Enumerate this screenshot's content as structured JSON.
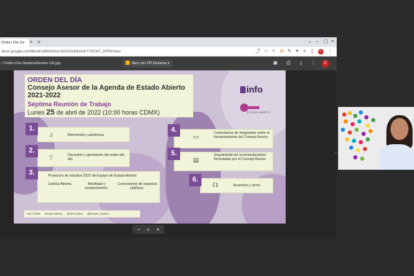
{
  "browser": {
    "tab_title": "Orden Día Se",
    "url": "drive.google.com/file/d/1d4bGOmo7jGOHzKtImHFYV91HT_I0PW/view",
    "profile_initial": "C"
  },
  "viewer": {
    "file_title": "r Orden Día-SeptimaSesión CA.jpg",
    "open_with_label": "Abrir con ZIP Extractor",
    "avatar_initial": "C"
  },
  "slide": {
    "title_line1": "ORDEN DEL DÍA",
    "title_line2": "Consejo Asesor de la Agenda de Estado Abierto 2021-2022",
    "subtitle": "Séptima Reunión de Trabajo",
    "date_prefix": "Lunes",
    "date_day": "25",
    "date_rest": "de abril de 2022 (10:00 horas CDMX)",
    "logo_text": "info",
    "logo_sub": "ESTADO ABIERTO",
    "items": [
      {
        "number": "1.",
        "text": "Bienvenida y asistencia."
      },
      {
        "number": "2.",
        "text": "Discusión y aprobación del orden del día."
      },
      {
        "number": "3.",
        "text": "Proyectos de estudios 2022 del Equipo de Estado Abierto:"
      },
      {
        "number": "4.",
        "text": "Comentarios de integrantes sobre el funcionamiento del Consejo Asesor."
      },
      {
        "number": "5.",
        "text": "Seguimiento de recomendaciones formuladas por el Consejo Asesor."
      },
      {
        "number": "6.",
        "text": "Acuerdos y cierre."
      }
    ],
    "projects": [
      "Justicia Abierta.",
      "Movilidad y mantenimiento.",
      "Concesiones de espacios públicos."
    ],
    "footer": [
      "Info CDMX",
      "Estado Abierto",
      "@InfoCdMex",
      "@Estado_Abierto"
    ]
  },
  "zoom": {
    "minus": "−",
    "plus": "+"
  }
}
